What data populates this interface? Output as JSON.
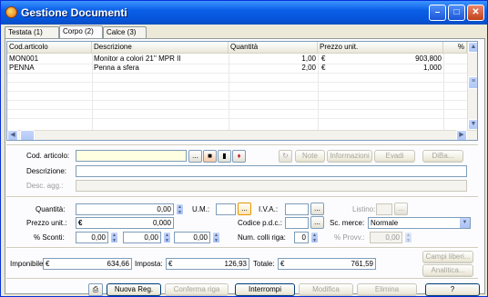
{
  "window": {
    "title": "Gestione Documenti"
  },
  "tabs": [
    {
      "label": "Testata (1)"
    },
    {
      "label": "Corpo (2)"
    },
    {
      "label": "Calce (3)"
    }
  ],
  "grid": {
    "columns": [
      "Cod.articolo",
      "Descrizione",
      "Quantità",
      "Prezzo unit.",
      "%"
    ],
    "rows": [
      {
        "code": "MON001",
        "desc": "Monitor a colori 21'' MPR II",
        "qty": "1,00",
        "cur": "€",
        "price": "903,800"
      },
      {
        "code": "PENNA",
        "desc": "Penna a sfera",
        "qty": "2,00",
        "cur": "€",
        "price": "1,000"
      }
    ]
  },
  "article": {
    "cod_label": "Cod. articolo:",
    "desc_label": "Descrizione:",
    "descagg_label": "Desc. agg.:",
    "note_label": "Note",
    "info_label": "Informazioni",
    "evadi_label": "Evadi",
    "diba_label": "DiBa..."
  },
  "detail": {
    "qty_label": "Quantità:",
    "qty_value": "0,00",
    "um_label": "U.M.:",
    "iva_label": "I.V.A.:",
    "listino_label": "Listino:",
    "prezzo_label": "Prezzo unit.:",
    "currency": "€",
    "prezzo_value": "0,000",
    "codice_label": "Codice p.d.c.:",
    "sc_label": "Sc. merce:",
    "sc_value": "Normale",
    "sconti_label": "% Sconti:",
    "sconti": [
      "0,00",
      "0,00",
      "0,00"
    ],
    "colli_label": "Num. colli riga:",
    "colli_value": "0",
    "provv_label": "% Provv.:",
    "provv_value": "0,00"
  },
  "totals": {
    "imponibile_label": "Imponibile:",
    "imponibile_cur": "€",
    "imponibile_value": "634,66",
    "imposta_label": "Imposta:",
    "imposta_cur": "€",
    "imposta_value": "126,93",
    "totale_label": "Totale:",
    "totale_cur": "€",
    "totale_value": "761,59",
    "campi_label": "Campi liberi...",
    "analitica_label": "Analitica..."
  },
  "footer": {
    "nuova": "Nuova Reg.",
    "conferma": "Conferma riga",
    "interrompi": "Interrompi",
    "modifica": "Modifica",
    "elimina": "Elimina",
    "help": "?"
  }
}
